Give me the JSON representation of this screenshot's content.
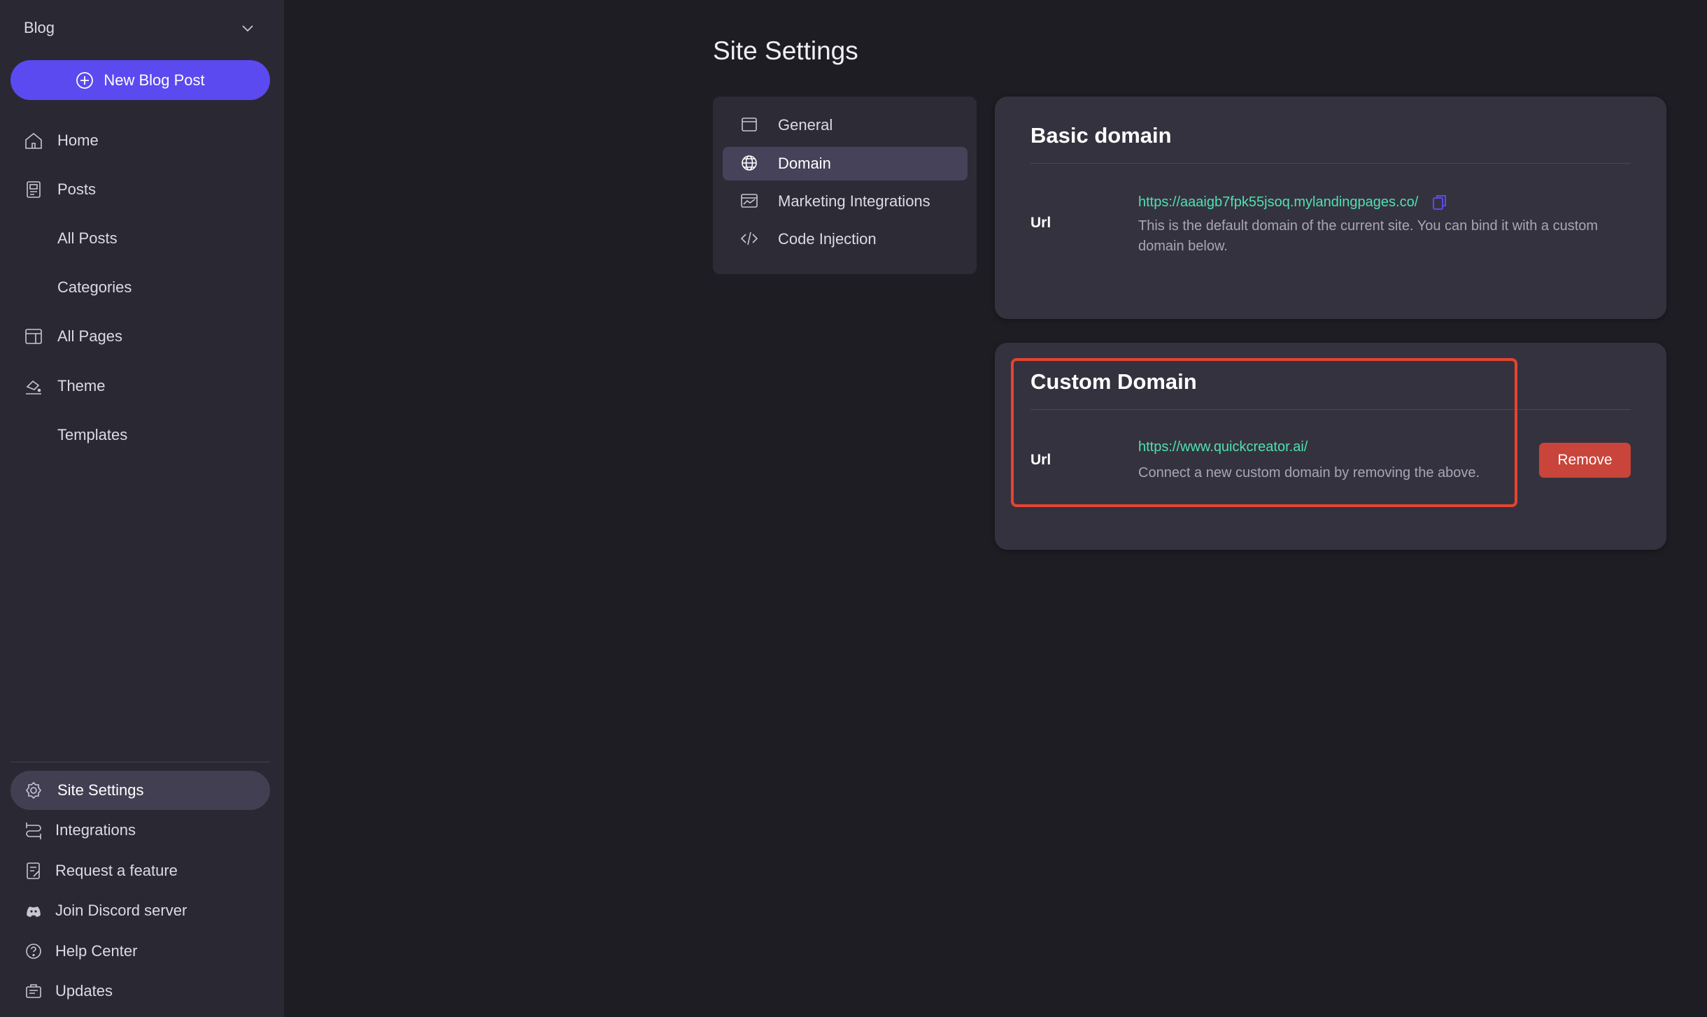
{
  "sidebar": {
    "workspace": "Blog",
    "new_post_label": "New Blog Post",
    "items": [
      {
        "label": "Home",
        "icon": "home-icon"
      },
      {
        "label": "Posts",
        "icon": "posts-icon"
      },
      {
        "label": "All Posts"
      },
      {
        "label": "Categories"
      },
      {
        "label": "All Pages",
        "icon": "pages-icon"
      },
      {
        "label": "Theme",
        "icon": "theme-icon"
      },
      {
        "label": "Templates"
      }
    ],
    "bottom_items": [
      {
        "label": "Site Settings",
        "icon": "gear-icon",
        "active": true
      },
      {
        "label": "Integrations",
        "icon": "integrations-icon"
      },
      {
        "label": "Request a feature",
        "icon": "request-icon"
      },
      {
        "label": "Join Discord server",
        "icon": "discord-icon"
      },
      {
        "label": "Help Center",
        "icon": "help-icon"
      },
      {
        "label": "Updates",
        "icon": "updates-icon"
      }
    ]
  },
  "main": {
    "title": "Site Settings",
    "settings_nav": [
      {
        "label": "General",
        "icon": "browser-icon"
      },
      {
        "label": "Domain",
        "icon": "globe-icon",
        "active": true
      },
      {
        "label": "Marketing Integrations",
        "icon": "marketing-icon"
      },
      {
        "label": "Code Injection",
        "icon": "code-icon"
      }
    ],
    "basic_domain": {
      "title": "Basic domain",
      "url_label": "Url",
      "url": "https://aaaigb7fpk55jsoq.mylandingpages.co/",
      "description": "This is the default domain of the current site. You can bind it with a custom domain below."
    },
    "custom_domain": {
      "title": "Custom Domain",
      "url_label": "Url",
      "url": "https://www.quickcreator.ai/",
      "description": "Connect a new custom domain by removing the above.",
      "remove_label": "Remove"
    }
  },
  "colors": {
    "accent": "#5b4af0",
    "link": "#4fe0b0",
    "danger": "#c9443a",
    "highlight": "#e8432e"
  }
}
